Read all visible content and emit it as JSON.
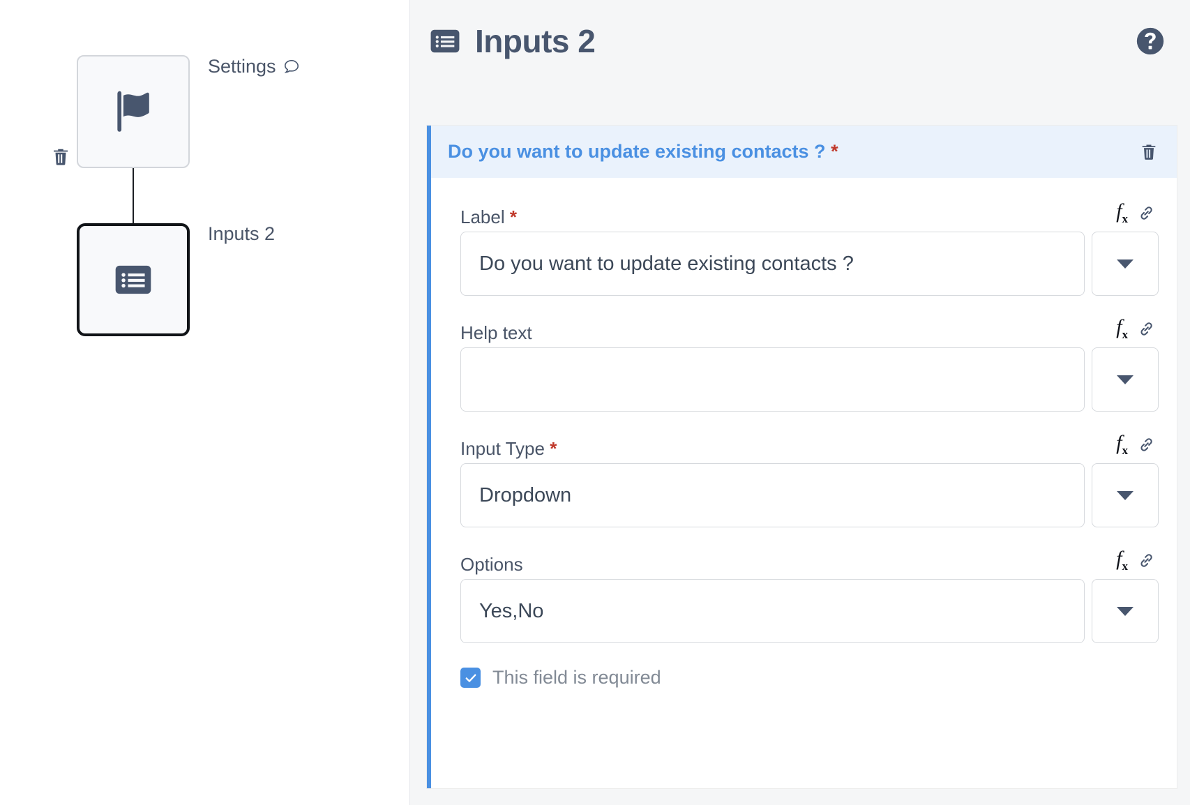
{
  "canvas": {
    "nodes": [
      {
        "id": "settings",
        "label": "Settings",
        "icon": "flag-icon",
        "selected": false,
        "has_comment": true,
        "has_trash": true
      },
      {
        "id": "inputs2",
        "label": "Inputs 2",
        "icon": "form-list-icon",
        "selected": true,
        "has_comment": false,
        "has_trash": false
      }
    ]
  },
  "panel": {
    "title": "Inputs 2",
    "title_icon": "form-list-icon",
    "help_icon": "help-circle-icon"
  },
  "card": {
    "header_title": "Do you want to update existing contacts ?",
    "header_required_mark": "*",
    "delete_icon": "trash-icon",
    "accent_color": "#4a90e2",
    "header_bg": "#eaf2fc",
    "fields": [
      {
        "label": "Label",
        "required_mark": "*",
        "value": "Do you want to update existing contacts ?",
        "placeholder": "",
        "fx_label": "f",
        "fx_sub": "x",
        "fx_icon": "function-icon",
        "link_icon": "chain-link-icon",
        "caret_icon": "chevron-down-icon"
      },
      {
        "label": "Help text",
        "required_mark": "",
        "value": "",
        "placeholder": "",
        "fx_label": "f",
        "fx_sub": "x",
        "fx_icon": "function-icon",
        "link_icon": "chain-link-icon",
        "caret_icon": "chevron-down-icon"
      },
      {
        "label": "Input Type",
        "required_mark": "*",
        "value": "Dropdown",
        "placeholder": "",
        "fx_label": "f",
        "fx_sub": "x",
        "fx_icon": "function-icon",
        "link_icon": "chain-link-icon",
        "caret_icon": "chevron-down-icon"
      },
      {
        "label": "Options",
        "required_mark": "",
        "value": "Yes,No",
        "placeholder": "",
        "fx_label": "f",
        "fx_sub": "x",
        "fx_icon": "function-icon",
        "link_icon": "chain-link-icon",
        "caret_icon": "chevron-down-icon"
      }
    ],
    "required_checkbox": {
      "label": "This field is required",
      "checked": true,
      "check_glyph": "✓"
    }
  }
}
